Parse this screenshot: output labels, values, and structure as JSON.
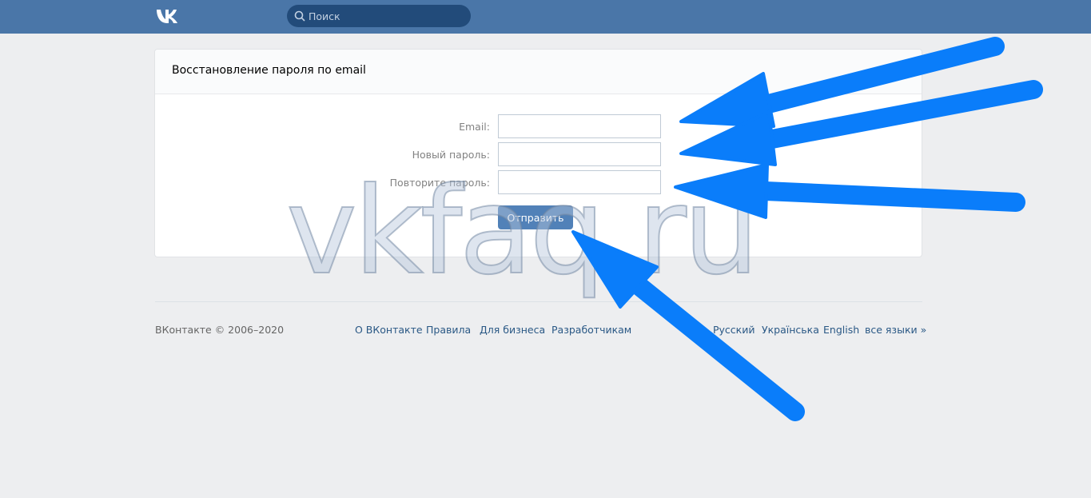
{
  "header": {
    "logo_text": "VK",
    "search": {
      "placeholder": "Поиск"
    }
  },
  "card": {
    "title": "Восстановление пароля по email",
    "fields": [
      {
        "label": "Email:",
        "value": ""
      },
      {
        "label": "Новый пароль:",
        "value": ""
      },
      {
        "label": "Повторите пароль:",
        "value": ""
      }
    ],
    "submit_label": "Отправить"
  },
  "footer": {
    "copyright": "ВКонтакте © 2006–2020",
    "links": [
      "О ВКонтакте",
      "Правила",
      "Для бизнеса",
      "Разработчикам"
    ],
    "languages": [
      "Русский",
      "Українська",
      "English",
      "все языки »"
    ]
  },
  "watermark": "vkfaq.ru",
  "colors": {
    "topbar": "#4a76a8",
    "button": "#5181b8",
    "link": "#2a5885",
    "arrow": "#0a7dfa"
  },
  "icons": [
    "vk-logo",
    "search-icon",
    "annotation-arrow"
  ]
}
